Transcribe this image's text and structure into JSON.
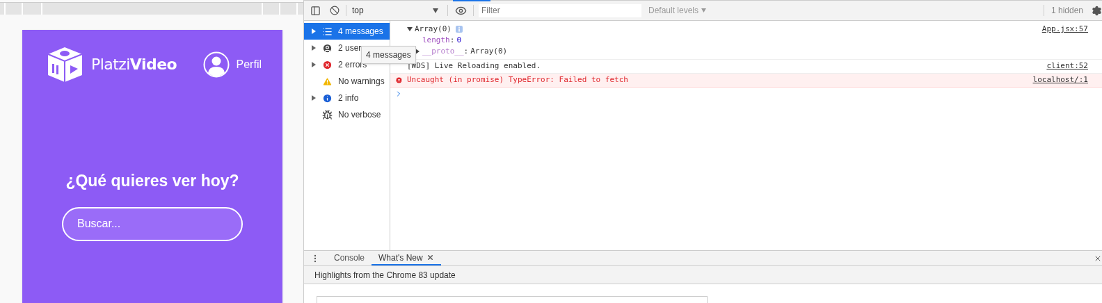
{
  "app": {
    "logo_light": "Platzi",
    "logo_bold": "Video",
    "profile_label": "Perfil",
    "heading": "¿Qué quieres ver hoy?",
    "search": {
      "placeholder": "Buscar..."
    }
  },
  "toolbar": {
    "context": "top",
    "filter": {
      "placeholder": "Filter"
    },
    "levels": "Default levels",
    "hidden": "1 hidden"
  },
  "sidebar": {
    "items": [
      {
        "label": "4 messages",
        "kind": "all",
        "selected": true,
        "expandable": true
      },
      {
        "label": "2 user",
        "kind": "user",
        "selected": false,
        "expandable": true
      },
      {
        "label": "2 errors",
        "kind": "error",
        "selected": false,
        "expandable": true
      },
      {
        "label": "No warnings",
        "kind": "warning",
        "selected": false,
        "expandable": false
      },
      {
        "label": "2 info",
        "kind": "info",
        "selected": false,
        "expandable": true
      },
      {
        "label": "No verbose",
        "kind": "verbose",
        "selected": false,
        "expandable": false
      }
    ]
  },
  "tooltip": "4 messages",
  "console": {
    "messages": [
      {
        "kind": "object",
        "text": "Array(0)",
        "delimiter": ":",
        "expanded": true,
        "source": "App.jsx:57",
        "properties": [
          {
            "key": "length",
            "value": "0",
            "expandable": false
          },
          {
            "key": "__proto__",
            "value": "Array(0)",
            "expandable": true
          }
        ]
      },
      {
        "kind": "log",
        "text": "[WDS] Live Reloading enabled.",
        "source": "client:52"
      },
      {
        "kind": "error",
        "text": "Uncaught (in promise) TypeError: Failed to fetch",
        "source": "localhost/:1"
      }
    ]
  },
  "drawer": {
    "tabs": [
      {
        "label": "Console",
        "selected": false,
        "closable": false
      },
      {
        "label": "What's New",
        "selected": true,
        "closable": true
      }
    ],
    "title": "Highlights from the Chrome 83 update"
  }
}
